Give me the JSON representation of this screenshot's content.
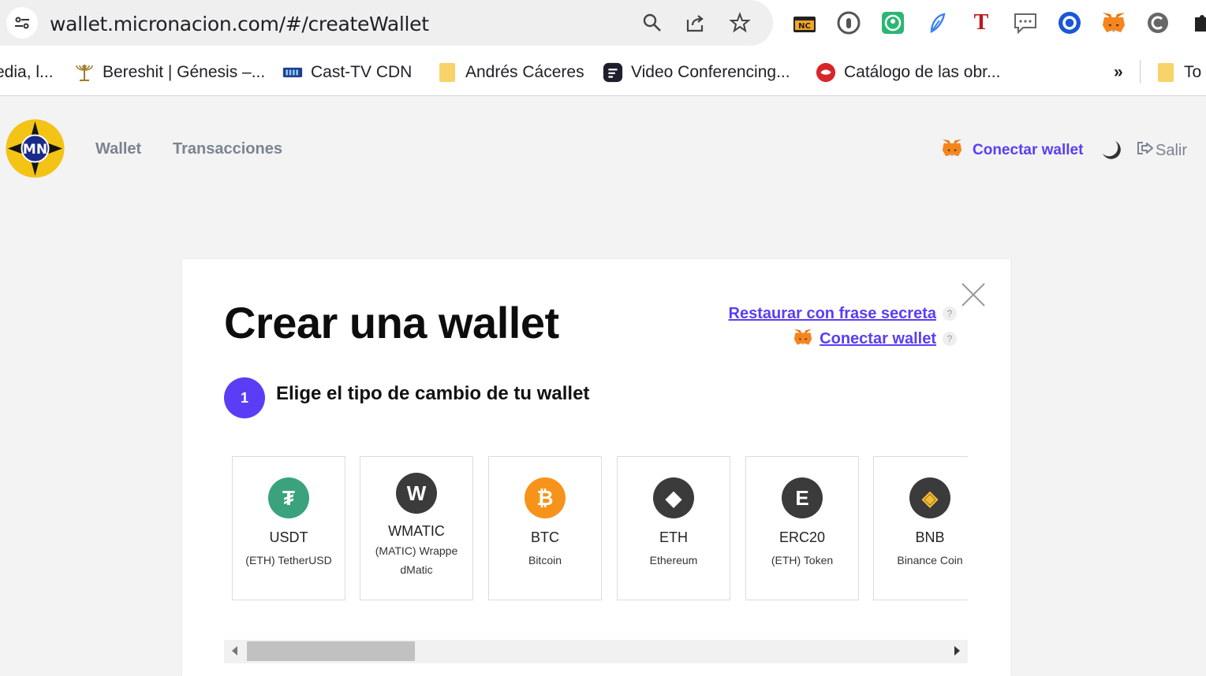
{
  "browser": {
    "url": "wallet.micronacion.com/#/createWallet",
    "bookmarks": [
      {
        "label": "edia, l..."
      },
      {
        "label": "Bereshit | Génesis –..."
      },
      {
        "label": "Cast-TV CDN"
      },
      {
        "label": "Andrés Cáceres"
      },
      {
        "label": "Video Conferencing..."
      },
      {
        "label": "Catálogo de las obr..."
      },
      {
        "label": "»"
      },
      {
        "label": "To"
      }
    ],
    "extension_t": "T"
  },
  "header": {
    "nav": [
      "Wallet",
      "Transacciones"
    ],
    "connect_label": "Conectar wallet",
    "logout_label": "Salir"
  },
  "modal": {
    "title": "Crear una wallet",
    "restore_link": "Restaurar con frase secreta",
    "connect_link": "Conectar wallet",
    "help_glyph": "?",
    "step_number": "1",
    "step_text": "Elige el tipo de cambio de tu wallet",
    "coins": [
      {
        "name": "USDT",
        "desc": "(ETH) TetherUSD",
        "glyph": "₮",
        "color": "#3aa37d"
      },
      {
        "name": "WMATIC",
        "desc": "(MATIC) Wrappe dMatic",
        "glyph": "W",
        "color": "#3b3b3b"
      },
      {
        "name": "BTC",
        "desc": "Bitcoin",
        "glyph": "₿",
        "color": "#f7931a"
      },
      {
        "name": "ETH",
        "desc": "Ethereum",
        "glyph": "◆",
        "color": "#3b3b3b"
      },
      {
        "name": "ERC20",
        "desc": "(ETH) Token",
        "glyph": "E",
        "color": "#3b3b3b"
      },
      {
        "name": "BNB",
        "desc": "Binance Coin",
        "glyph": "◈",
        "color": "#3b3b3b"
      }
    ]
  },
  "colors": {
    "accent": "#5b3df5",
    "muted": "#7b8391"
  }
}
